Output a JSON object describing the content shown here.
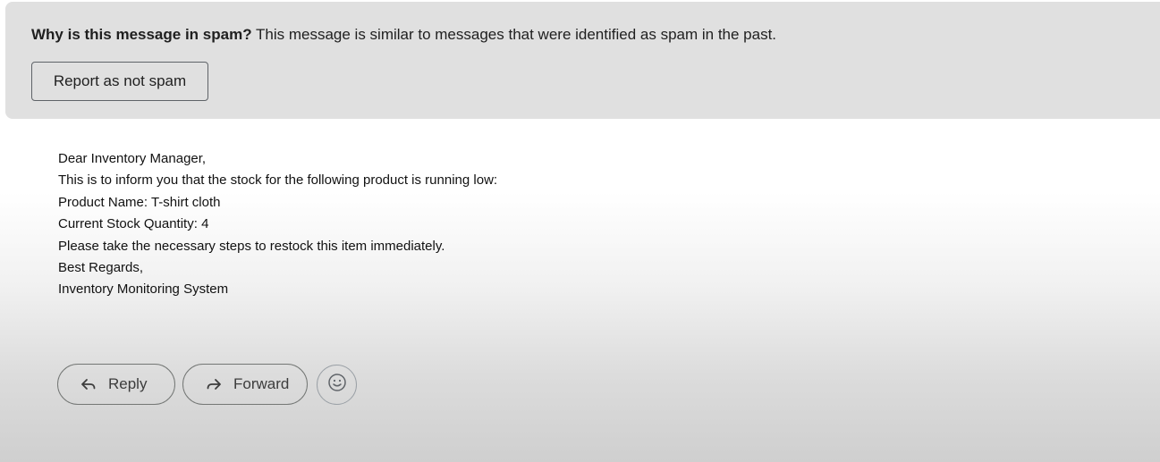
{
  "spam_banner": {
    "question": "Why is this message in spam?",
    "explanation": "This message is similar to messages that were identified as spam in the past.",
    "not_spam_label": "Report as not spam"
  },
  "email": {
    "lines": [
      "Dear Inventory Manager,",
      "This is to inform you that the stock for the following product is running low:",
      "Product Name: T-shirt cloth",
      "Current Stock Quantity: 4",
      "Please take the necessary steps to restock this item immediately.",
      "Best Regards,",
      "Inventory Monitoring System"
    ]
  },
  "actions": {
    "reply_label": "Reply",
    "reply_icon": "reply-arrow-icon",
    "forward_label": "Forward",
    "forward_icon": "forward-arrow-icon",
    "emoji_icon": "emoji-smile-icon"
  },
  "colors": {
    "banner_bg": "#e0e0e0",
    "text": "#1f1f1f",
    "outline": "#747775"
  }
}
